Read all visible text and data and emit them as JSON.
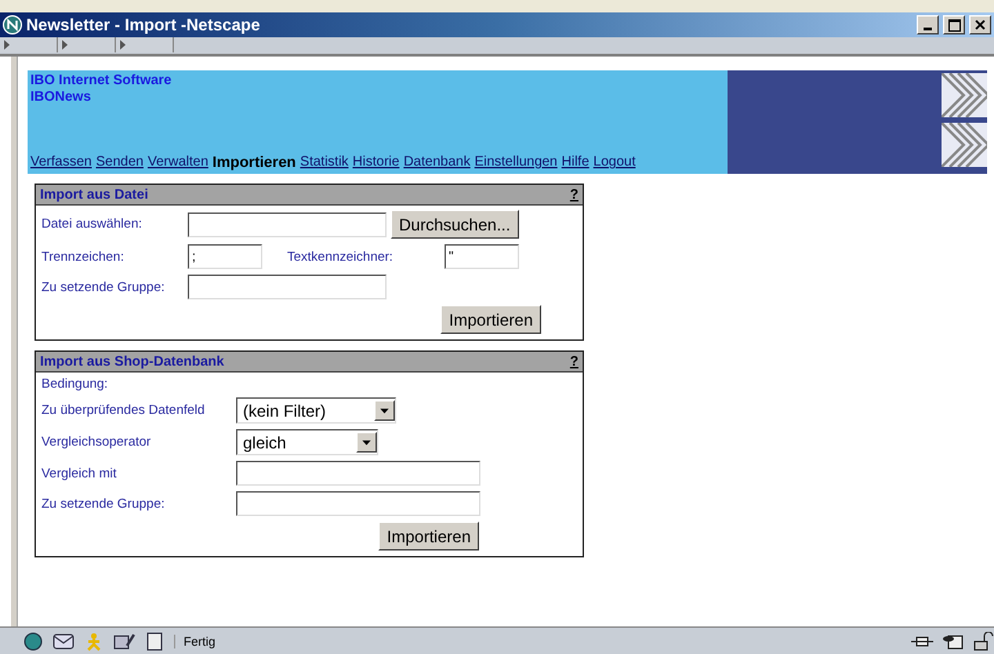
{
  "window": {
    "title": "Newsletter - Import -Netscape"
  },
  "banner": {
    "company": "IBO Internet Software",
    "product": "IBONews"
  },
  "nav": [
    {
      "label": "Verfassen",
      "selected": false
    },
    {
      "label": "Senden",
      "selected": false
    },
    {
      "label": "Verwalten",
      "selected": false
    },
    {
      "label": "Importieren",
      "selected": true
    },
    {
      "label": "Statistik",
      "selected": false
    },
    {
      "label": "Historie",
      "selected": false
    },
    {
      "label": "Datenbank",
      "selected": false
    },
    {
      "label": "Einstellungen",
      "selected": false
    },
    {
      "label": "Hilfe",
      "selected": false
    },
    {
      "label": "Logout",
      "selected": false
    }
  ],
  "file_import": {
    "title": "Import aus Datei",
    "help": "?",
    "file_label": "Datei auswählen:",
    "browse_button": "Durchsuchen...",
    "separator_label": "Trennzeichen:",
    "separator_value": ";",
    "quote_label": "Textkennzeichner:",
    "quote_value": "\"",
    "group_label": "Zu setzende Gruppe:",
    "submit": "Importieren"
  },
  "shop_import": {
    "title": "Import aus Shop-Datenbank",
    "help": "?",
    "condition_label": "Bedingung:",
    "field_label": "Zu überprüfendes Datenfeld",
    "field_value": "(kein Filter)",
    "operator_label": "Vergleichsoperator",
    "operator_value": "gleich",
    "compare_label": "Vergleich mit",
    "group_label": "Zu setzende Gruppe:",
    "submit": "Importieren"
  },
  "status_bar": {
    "text": "Fertig"
  }
}
